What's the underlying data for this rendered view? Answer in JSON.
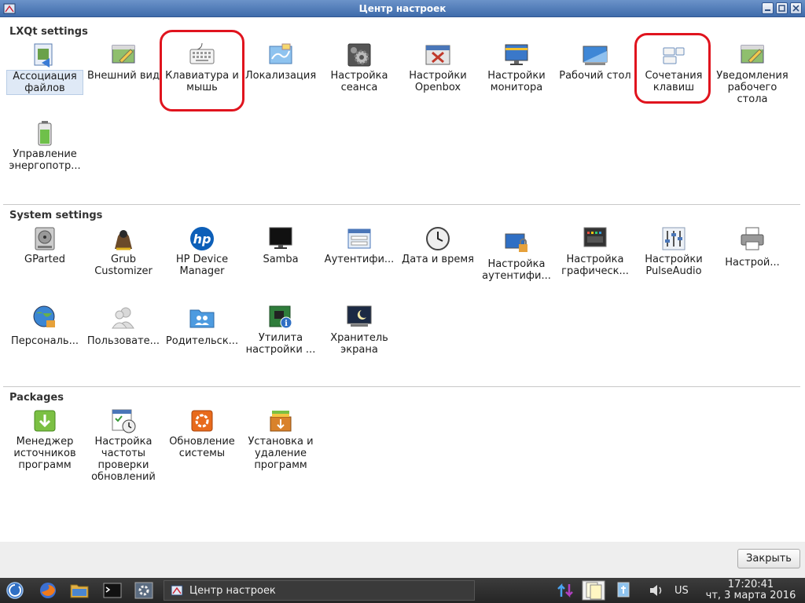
{
  "window": {
    "title": "Центр настроек",
    "controls": [
      "minimize-icon",
      "maximize-icon",
      "close-icon"
    ]
  },
  "sections": {
    "lxqt": {
      "title": "LXQt settings",
      "items": [
        {
          "label": "Ассоциация\nфайлов",
          "icon": "file-association-icon",
          "selected": true
        },
        {
          "label": "Внешний вид",
          "icon": "appearance-icon"
        },
        {
          "label": "Клавиатура и\nмышь",
          "icon": "keyboard-icon"
        },
        {
          "label": "Локализация",
          "icon": "locale-map-icon"
        },
        {
          "label": "Настройка\nсеанса",
          "icon": "session-gear-icon"
        },
        {
          "label": "Настройки\nOpenbox",
          "icon": "openbox-icon"
        },
        {
          "label": "Настройки\nмонитора",
          "icon": "monitor-icon"
        },
        {
          "label": "Рабочий стол",
          "icon": "desktop-icon"
        },
        {
          "label": "Сочетания\nклавиш",
          "icon": "shortcut-keys-icon"
        },
        {
          "label": "Уведомления\nрабочего\nстола",
          "icon": "notifications-icon"
        },
        {
          "label": "Управление\nэнергопотр...",
          "icon": "battery-icon"
        }
      ]
    },
    "system": {
      "title": "System settings",
      "items": [
        {
          "label": "GParted",
          "icon": "disk-icon"
        },
        {
          "label": "Grub\nCustomizer",
          "icon": "gnu-icon"
        },
        {
          "label": "HP Device\nManager",
          "icon": "hp-logo-icon"
        },
        {
          "label": "Samba",
          "icon": "samba-monitor-icon"
        },
        {
          "label": "Аутентифи...",
          "icon": "login-form-icon"
        },
        {
          "label": "Дата и время",
          "icon": "clock-icon"
        },
        {
          "label": "Настройка\nаутентифи...",
          "icon": "auth-lock-icon"
        },
        {
          "label": "Настройка\nграфическ...",
          "icon": "graphics-icon"
        },
        {
          "label": "Настройки\nPulseAudio",
          "icon": "equalizer-icon"
        },
        {
          "label": "Настрой...",
          "icon": "printer-icon"
        },
        {
          "label": "Персональ...",
          "icon": "personal-globe-icon"
        },
        {
          "label": "Пользовате...",
          "icon": "users-icon"
        },
        {
          "label": "Родительск...",
          "icon": "parental-folder-icon"
        },
        {
          "label": "Утилита\nнастройки ...",
          "icon": "circuit-board-icon"
        },
        {
          "label": "Хранитель\nэкрана",
          "icon": "screensaver-icon"
        }
      ]
    },
    "packages": {
      "title": "Packages",
      "items": [
        {
          "label": "Менеджер\nисточников\nпрограмм",
          "icon": "download-icon"
        },
        {
          "label": "Настройка\nчастоты\nпроверки\nобновлений",
          "icon": "update-schedule-icon"
        },
        {
          "label": "Обновление\nсистемы",
          "icon": "system-update-icon"
        },
        {
          "label": "Установка и\nудаление\nпрограмм",
          "icon": "package-box-icon"
        }
      ]
    }
  },
  "highlight_color": "#e0141e",
  "footer": {
    "close_label": "Закрыть"
  },
  "taskbar": {
    "task_label": "Центр настроек",
    "language": "US",
    "time": "17:20:41",
    "date": "чт, 3 марта 2016"
  }
}
